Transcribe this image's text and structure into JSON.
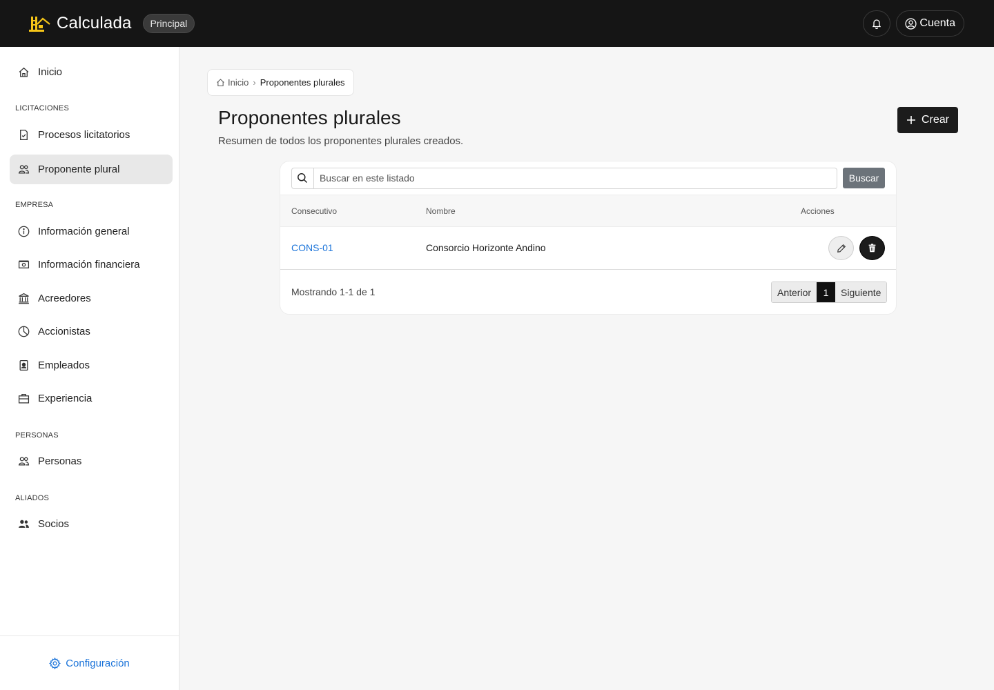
{
  "app": {
    "name": "Calculada",
    "env_badge": "Principal"
  },
  "header": {
    "account_label": "Cuenta"
  },
  "sidebar": {
    "home": {
      "label": "Inicio",
      "icon": "home-icon"
    },
    "sections": [
      {
        "title": "LICITACIONES",
        "items": [
          {
            "label": "Procesos licitatorios",
            "icon": "file-check-icon"
          },
          {
            "label": "Proponente plural",
            "icon": "users-icon",
            "active": true
          }
        ]
      },
      {
        "title": "EMPRESA",
        "items": [
          {
            "label": "Información general",
            "icon": "info-icon"
          },
          {
            "label": "Información financiera",
            "icon": "cash-icon"
          },
          {
            "label": "Acreedores",
            "icon": "bank-icon"
          },
          {
            "label": "Accionistas",
            "icon": "pie-chart-icon"
          },
          {
            "label": "Empleados",
            "icon": "badge-icon"
          },
          {
            "label": "Experiencia",
            "icon": "briefcase-icon"
          }
        ]
      },
      {
        "title": "PERSONAS",
        "items": [
          {
            "label": "Personas",
            "icon": "people-icon"
          }
        ]
      },
      {
        "title": "ALIADOS",
        "items": [
          {
            "label": "Socios",
            "icon": "people-fill-icon"
          }
        ]
      }
    ],
    "settings_label": "Configuración"
  },
  "breadcrumb": {
    "home": "Inicio",
    "current": "Proponentes plurales"
  },
  "page": {
    "title": "Proponentes plurales",
    "subtitle": "Resumen de todos los proponentes plurales creados.",
    "create_label": "Crear"
  },
  "search": {
    "placeholder": "Buscar en este listado",
    "button_label": "Buscar"
  },
  "table": {
    "columns": [
      "Consecutivo",
      "Nombre",
      "Acciones"
    ],
    "rows": [
      {
        "code": "CONS-01",
        "name": "Consorcio Horizonte Andino"
      }
    ]
  },
  "pagination": {
    "summary": "Mostrando 1-1 de 1",
    "prev": "Anterior",
    "current": "1",
    "next": "Siguiente"
  },
  "colors": {
    "topbar": "#151515",
    "accent_link": "#1a73d9",
    "logo": "#f5c518"
  }
}
